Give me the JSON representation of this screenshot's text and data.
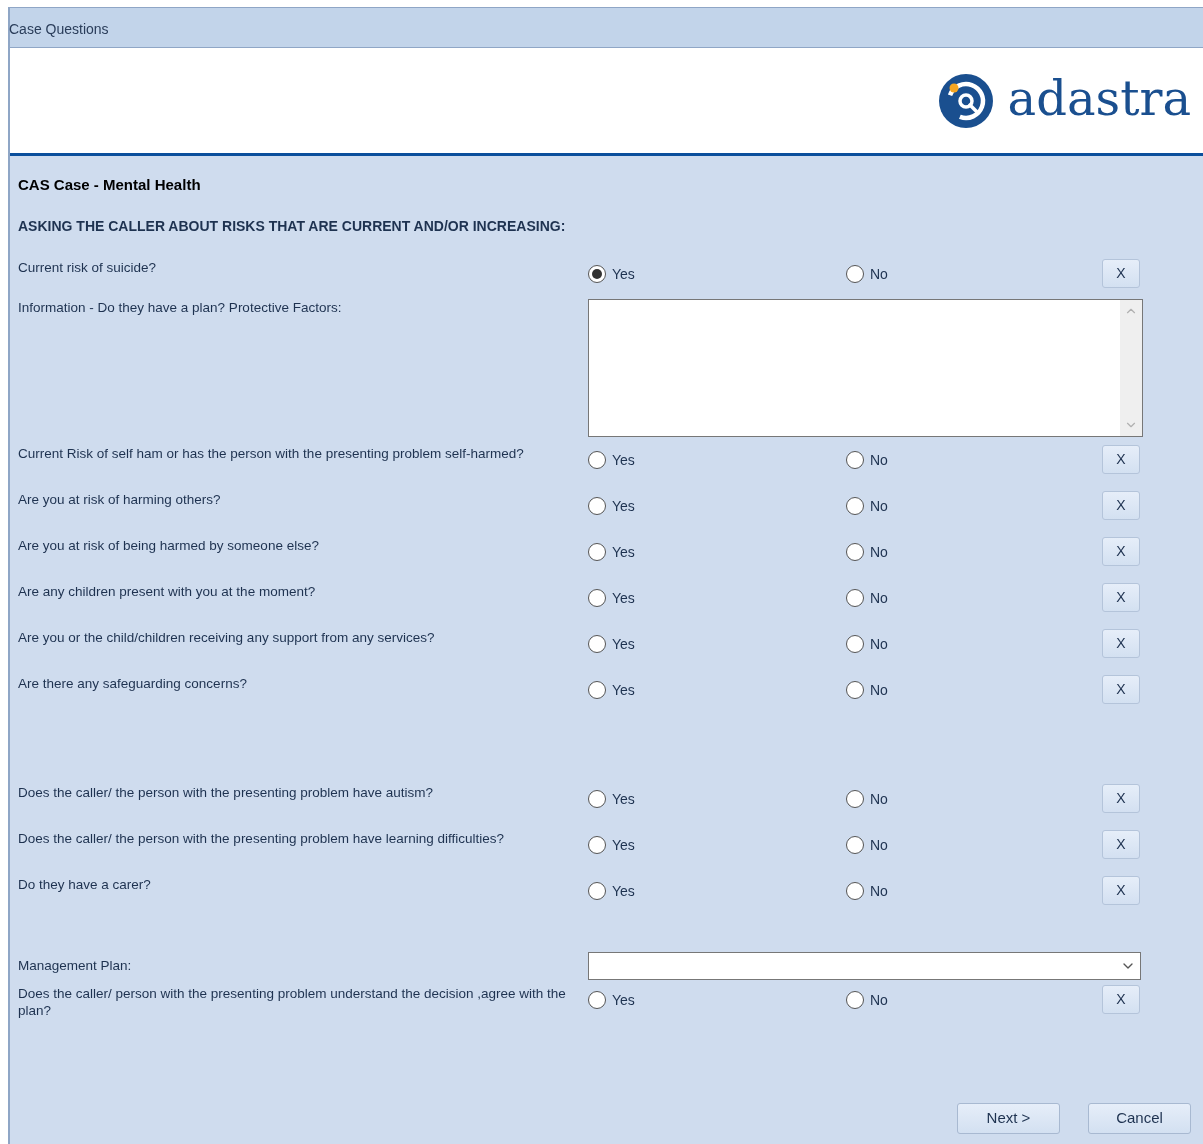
{
  "window": {
    "title": "Case Questions"
  },
  "logo": {
    "text": "adastra"
  },
  "form": {
    "title": "CAS Case - Mental Health",
    "subtitle": "ASKING THE CALLER ABOUT RISKS THAT ARE CURRENT AND/OR INCREASING:",
    "groups": [
      [
        {
          "kind": "radio",
          "label": "Current risk of suicide?",
          "options": [
            {
              "label": "Yes",
              "selected": true
            },
            {
              "label": "No",
              "selected": false
            }
          ],
          "clear": "X"
        },
        {
          "kind": "textarea",
          "label": "Information - Do they have a plan? Protective Factors:"
        },
        {
          "kind": "radio",
          "label": "Current Risk of self ham or has the person with the presenting problem self-harmed?",
          "options": [
            {
              "label": "Yes",
              "selected": false
            },
            {
              "label": "No",
              "selected": false
            }
          ],
          "clear": "X"
        },
        {
          "kind": "radio",
          "label": "Are you at risk of harming others?",
          "options": [
            {
              "label": "Yes",
              "selected": false
            },
            {
              "label": "No",
              "selected": false
            }
          ],
          "clear": "X"
        },
        {
          "kind": "radio",
          "label": "Are you at risk of being harmed by someone else?",
          "options": [
            {
              "label": "Yes",
              "selected": false
            },
            {
              "label": "No",
              "selected": false
            }
          ],
          "clear": "X"
        },
        {
          "kind": "radio",
          "label": "Are any children present with you at the moment?",
          "options": [
            {
              "label": "Yes",
              "selected": false
            },
            {
              "label": "No",
              "selected": false
            }
          ],
          "clear": "X"
        },
        {
          "kind": "radio",
          "label": "Are you or the child/children receiving any support from any services?",
          "options": [
            {
              "label": "Yes",
              "selected": false
            },
            {
              "label": "No",
              "selected": false
            }
          ],
          "clear": "X"
        },
        {
          "kind": "radio",
          "label": "Are there any safeguarding concerns?",
          "options": [
            {
              "label": "Yes",
              "selected": false
            },
            {
              "label": "No",
              "selected": false
            }
          ],
          "clear": "X"
        }
      ],
      [
        {
          "kind": "radio",
          "label": "Does the caller/ the person with the presenting problem have autism?",
          "options": [
            {
              "label": "Yes",
              "selected": false
            },
            {
              "label": "No",
              "selected": false
            }
          ],
          "clear": "X"
        },
        {
          "kind": "radio",
          "label": "Does the caller/ the person with the presenting problem have learning difficulties?",
          "options": [
            {
              "label": "Yes",
              "selected": false
            },
            {
              "label": "No",
              "selected": false
            }
          ],
          "clear": "X"
        },
        {
          "kind": "radio",
          "label": "Do they have a carer?",
          "options": [
            {
              "label": "Yes",
              "selected": false
            },
            {
              "label": "No",
              "selected": false
            }
          ],
          "clear": "X"
        }
      ],
      [
        {
          "kind": "dropdown",
          "label": "Management Plan:"
        },
        {
          "kind": "radio",
          "label": "Does the caller/ person with the presenting problem understand the decision ,agree with the plan?",
          "options": [
            {
              "label": "Yes",
              "selected": false
            },
            {
              "label": "No",
              "selected": false
            }
          ],
          "clear": "X"
        }
      ]
    ]
  },
  "buttons": [
    "Next >",
    "Cancel"
  ]
}
